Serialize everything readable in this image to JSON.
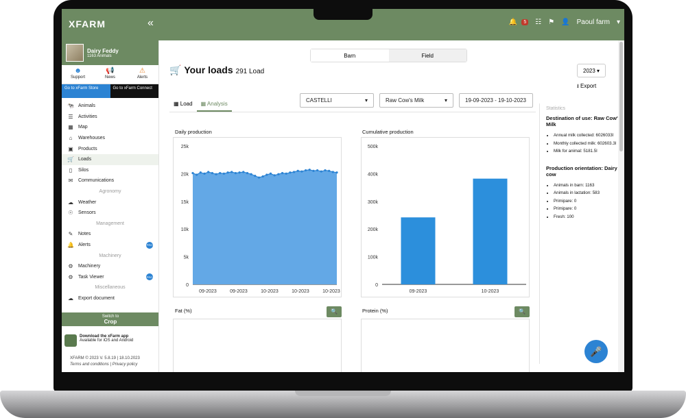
{
  "topbar": {
    "logo": "XFARM",
    "collapse": "«",
    "alerts_count": "5",
    "user": "Paoul farm"
  },
  "farm": {
    "name": "Dairy Feddy",
    "animals": "1163 Animals"
  },
  "quick": [
    {
      "label": "Support",
      "icon": "support-icon"
    },
    {
      "label": "News",
      "icon": "megaphone-icon"
    },
    {
      "label": "Alerts",
      "icon": "warning-icon",
      "badge": "0"
    }
  ],
  "stores": {
    "store": "Go to xFarm Store",
    "connect": "Go to xFarm Connect"
  },
  "nav": [
    {
      "label": "Animals",
      "icon": "cow-icon"
    },
    {
      "label": "Activities",
      "icon": "list-icon"
    },
    {
      "label": "Map",
      "icon": "map-icon"
    },
    {
      "label": "Warehouses",
      "icon": "warehouse-icon"
    },
    {
      "label": "Products",
      "icon": "box-icon"
    },
    {
      "label": "Loads",
      "icon": "cart-icon",
      "active": true
    },
    {
      "label": "Silos",
      "icon": "silo-icon"
    },
    {
      "label": "Communications",
      "icon": "chat-icon"
    },
    {
      "section": "Agronomy"
    },
    {
      "label": "Weather",
      "icon": "cloud-icon"
    },
    {
      "label": "Sensors",
      "icon": "sensor-icon"
    },
    {
      "section": "Management"
    },
    {
      "label": "Notes",
      "icon": "note-icon"
    },
    {
      "label": "Alerts",
      "icon": "bell-icon",
      "pro": "PRO"
    },
    {
      "section": "Machinery"
    },
    {
      "label": "Machinery",
      "icon": "tractor-icon"
    },
    {
      "label": "Task Viewer",
      "icon": "gear-icon",
      "pro": "PRO"
    },
    {
      "section": "Miscellaneous"
    },
    {
      "label": "Export document",
      "icon": "export-icon"
    }
  ],
  "switch": {
    "line1": "Switch to",
    "line2": "Crop"
  },
  "app": {
    "line1": "Download the xFarm app",
    "line2": "Available for iOS and Android"
  },
  "footer": {
    "line1": "XFARM © 2023 V. 5.8.19 | 18.10.2023",
    "line2": "Terms and conditions | Privacy policy"
  },
  "segment": {
    "left": "Barn",
    "right": "Field"
  },
  "page": {
    "title": "Your loads",
    "count": "291 Load",
    "year": "2023",
    "export": "Export"
  },
  "tabs": [
    {
      "label": "Load"
    },
    {
      "label": "Analysis",
      "active": true
    }
  ],
  "filters": {
    "site": "CASTELLI",
    "product": "Raw Cow's Milk",
    "dates": "19-09-2023 - 19-10-2023"
  },
  "stats": {
    "heading": "Statistics",
    "block1_title": "Destination of use: Raw Cow's Milk",
    "block1": [
      "Annual milk collected: 6026033l",
      "Monthly collected milk: 602603.3l",
      "Milk for animal: 5181.5l"
    ],
    "block2_title": "Production orientation: Dairy cow",
    "block2": [
      "Animals in barn: 1163",
      "Animals in lactation: 583",
      "Primipare: 0",
      "Primipare: 0",
      "Fresh: 100"
    ]
  },
  "charts": {
    "daily": "Daily production",
    "cumulative": "Cumulative production",
    "fat": "Fat (%)",
    "protein": "Protein (%)"
  },
  "chart_data": [
    {
      "type": "area",
      "title": "Daily production",
      "y_ticks": [
        "25k",
        "20k",
        "15k",
        "10k",
        "5k",
        "0"
      ],
      "ylim": [
        0,
        25000
      ],
      "x_ticks": [
        "09-2023",
        "09-2023",
        "10-2023",
        "10-2023",
        "10-2023"
      ],
      "values": [
        20100,
        19800,
        20200,
        20000,
        20300,
        20100,
        19900,
        20100,
        20000,
        20200,
        20300,
        20100,
        20200,
        20300,
        20100,
        19900,
        19600,
        19300,
        19500,
        19800,
        20000,
        19700,
        19900,
        20100,
        20000,
        20200,
        20300,
        20500,
        20400,
        20600,
        20700,
        20500,
        20600,
        20400,
        20600,
        20500,
        20300,
        20200
      ]
    },
    {
      "type": "bar",
      "title": "Cumulative production",
      "y_ticks": [
        "500k",
        "400k",
        "300k",
        "200k",
        "100k",
        "0"
      ],
      "ylim": [
        0,
        500000
      ],
      "categories": [
        "09-2023",
        "10-2023"
      ],
      "values": [
        242000,
        382000
      ],
      "color": "#2c8fdc"
    }
  ]
}
